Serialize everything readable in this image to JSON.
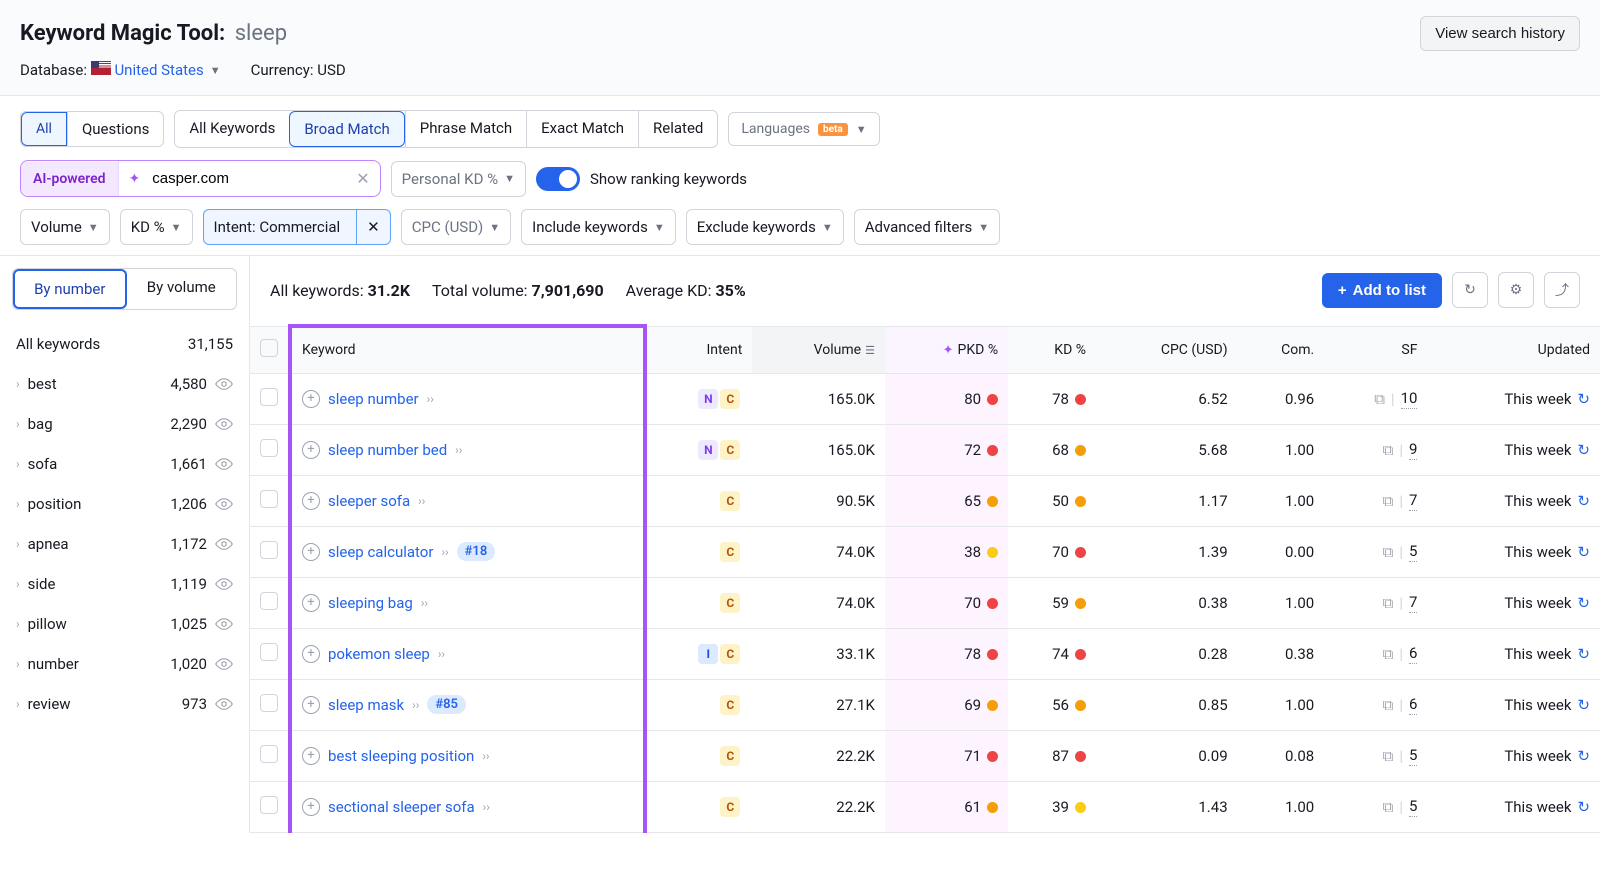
{
  "header": {
    "tool_title": "Keyword Magic Tool:",
    "query": "sleep",
    "history_btn": "View search history",
    "database_label": "Database:",
    "database_value": "United States",
    "currency_label": "Currency: USD"
  },
  "filters": {
    "mode_tabs": [
      "All",
      "Questions"
    ],
    "match_tabs": [
      "All Keywords",
      "Broad Match",
      "Phrase Match",
      "Exact Match",
      "Related"
    ],
    "match_active": "Broad Match",
    "languages_label": "Languages",
    "beta": "beta",
    "ai_label": "AI-powered",
    "ai_domain": "casper.com",
    "personal_kd": "Personal KD %",
    "show_ranking": "Show ranking keywords",
    "volume": "Volume",
    "kd": "KD %",
    "intent": "Intent: Commercial",
    "cpc": "CPC (USD)",
    "include": "Include keywords",
    "exclude": "Exclude keywords",
    "advanced": "Advanced filters"
  },
  "sidebar": {
    "tabs": {
      "by_number": "By number",
      "by_volume": "By volume"
    },
    "all_label": "All keywords",
    "all_count": "31,155",
    "groups": [
      {
        "name": "best",
        "count": "4,580"
      },
      {
        "name": "bag",
        "count": "2,290"
      },
      {
        "name": "sofa",
        "count": "1,661"
      },
      {
        "name": "position",
        "count": "1,206"
      },
      {
        "name": "apnea",
        "count": "1,172"
      },
      {
        "name": "side",
        "count": "1,119"
      },
      {
        "name": "pillow",
        "count": "1,025"
      },
      {
        "name": "number",
        "count": "1,020"
      },
      {
        "name": "review",
        "count": "973"
      }
    ]
  },
  "stats": {
    "all_kw_label": "All keywords:",
    "all_kw_value": "31.2K",
    "total_vol_label": "Total volume:",
    "total_vol_value": "7,901,690",
    "avg_kd_label": "Average KD:",
    "avg_kd_value": "35%"
  },
  "actions": {
    "add_to_list": "Add to list"
  },
  "columns": {
    "keyword": "Keyword",
    "intent": "Intent",
    "volume": "Volume",
    "pkd": "PKD %",
    "kd": "KD %",
    "cpc": "CPC (USD)",
    "com": "Com.",
    "sf": "SF",
    "updated": "Updated"
  },
  "rows": [
    {
      "kw": "sleep number",
      "rank": null,
      "intents": [
        "N",
        "C"
      ],
      "vol": "165.0K",
      "pkd": "80",
      "pkd_c": "d-red",
      "kd": "78",
      "kd_c": "d-red",
      "cpc": "6.52",
      "com": "0.96",
      "sf": "10",
      "upd": "This week"
    },
    {
      "kw": "sleep number bed",
      "rank": null,
      "intents": [
        "N",
        "C"
      ],
      "vol": "165.0K",
      "pkd": "72",
      "pkd_c": "d-red",
      "kd": "68",
      "kd_c": "d-orange",
      "cpc": "5.68",
      "com": "1.00",
      "sf": "9",
      "upd": "This week"
    },
    {
      "kw": "sleeper sofa",
      "rank": null,
      "intents": [
        "C"
      ],
      "vol": "90.5K",
      "pkd": "65",
      "pkd_c": "d-orange",
      "kd": "50",
      "kd_c": "d-orange",
      "cpc": "1.17",
      "com": "1.00",
      "sf": "7",
      "upd": "This week"
    },
    {
      "kw": "sleep calculator",
      "rank": "#18",
      "intents": [
        "C"
      ],
      "vol": "74.0K",
      "pkd": "38",
      "pkd_c": "d-yellow",
      "kd": "70",
      "kd_c": "d-red",
      "cpc": "1.39",
      "com": "0.00",
      "sf": "5",
      "upd": "This week"
    },
    {
      "kw": "sleeping bag",
      "rank": null,
      "intents": [
        "C"
      ],
      "vol": "74.0K",
      "pkd": "70",
      "pkd_c": "d-red",
      "kd": "59",
      "kd_c": "d-orange",
      "cpc": "0.38",
      "com": "1.00",
      "sf": "7",
      "upd": "This week"
    },
    {
      "kw": "pokemon sleep",
      "rank": null,
      "intents": [
        "I",
        "C"
      ],
      "vol": "33.1K",
      "pkd": "78",
      "pkd_c": "d-red",
      "kd": "74",
      "kd_c": "d-red",
      "cpc": "0.28",
      "com": "0.38",
      "sf": "6",
      "upd": "This week"
    },
    {
      "kw": "sleep mask",
      "rank": "#85",
      "intents": [
        "C"
      ],
      "vol": "27.1K",
      "pkd": "69",
      "pkd_c": "d-orange",
      "kd": "56",
      "kd_c": "d-orange",
      "cpc": "0.85",
      "com": "1.00",
      "sf": "6",
      "upd": "This week"
    },
    {
      "kw": "best sleeping position",
      "rank": null,
      "intents": [
        "C"
      ],
      "vol": "22.2K",
      "pkd": "71",
      "pkd_c": "d-red",
      "kd": "87",
      "kd_c": "d-red",
      "cpc": "0.09",
      "com": "0.08",
      "sf": "5",
      "upd": "This week"
    },
    {
      "kw": "sectional sleeper sofa",
      "rank": null,
      "intents": [
        "C"
      ],
      "vol": "22.2K",
      "pkd": "61",
      "pkd_c": "d-orange",
      "kd": "39",
      "kd_c": "d-yellow",
      "cpc": "1.43",
      "com": "1.00",
      "sf": "5",
      "upd": "This week"
    }
  ]
}
